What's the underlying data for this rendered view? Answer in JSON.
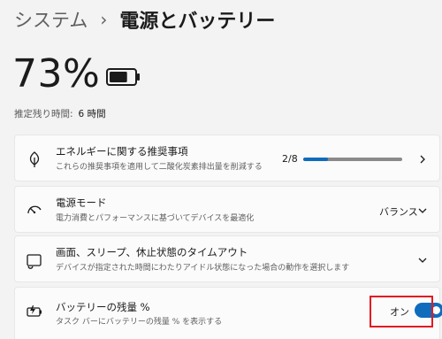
{
  "breadcrumb": {
    "parent": "システム",
    "separator": "›",
    "current": "電源とバッテリー"
  },
  "battery": {
    "percent_text": "73%",
    "level": 0.73,
    "remaining_label": "推定残り時間:",
    "remaining_value": "6 時間"
  },
  "cards": {
    "energy": {
      "title": "エネルギーに関する推奨事項",
      "desc": "これらの推奨事項を適用して二酸化炭素排出量を削減する",
      "progress_text": "2/8",
      "progress_fraction": 0.25,
      "icon": "leaf-icon"
    },
    "power_mode": {
      "title": "電源モード",
      "desc": "電力消費とパフォーマンスに基づいてデバイスを最適化",
      "value": "バランス",
      "icon": "gauge-icon"
    },
    "screen_sleep": {
      "title": "画面、スリープ、休止状態のタイムアウト",
      "desc": "デバイスが指定された時間にわたりアイドル状態になった場合の動作を選択します",
      "icon": "screen-sleep-icon"
    },
    "battery_pct": {
      "title": "バッテリーの残量 %",
      "desc": "タスク バーにバッテリーの残量 % を表示する",
      "toggle_label": "オン",
      "toggle_on": true,
      "icon": "battery-charging-icon"
    }
  },
  "colors": {
    "accent": "#0f6cbd",
    "highlight": "#e21a23",
    "background": "#f3f3f3",
    "card": "#fbfbfb"
  }
}
